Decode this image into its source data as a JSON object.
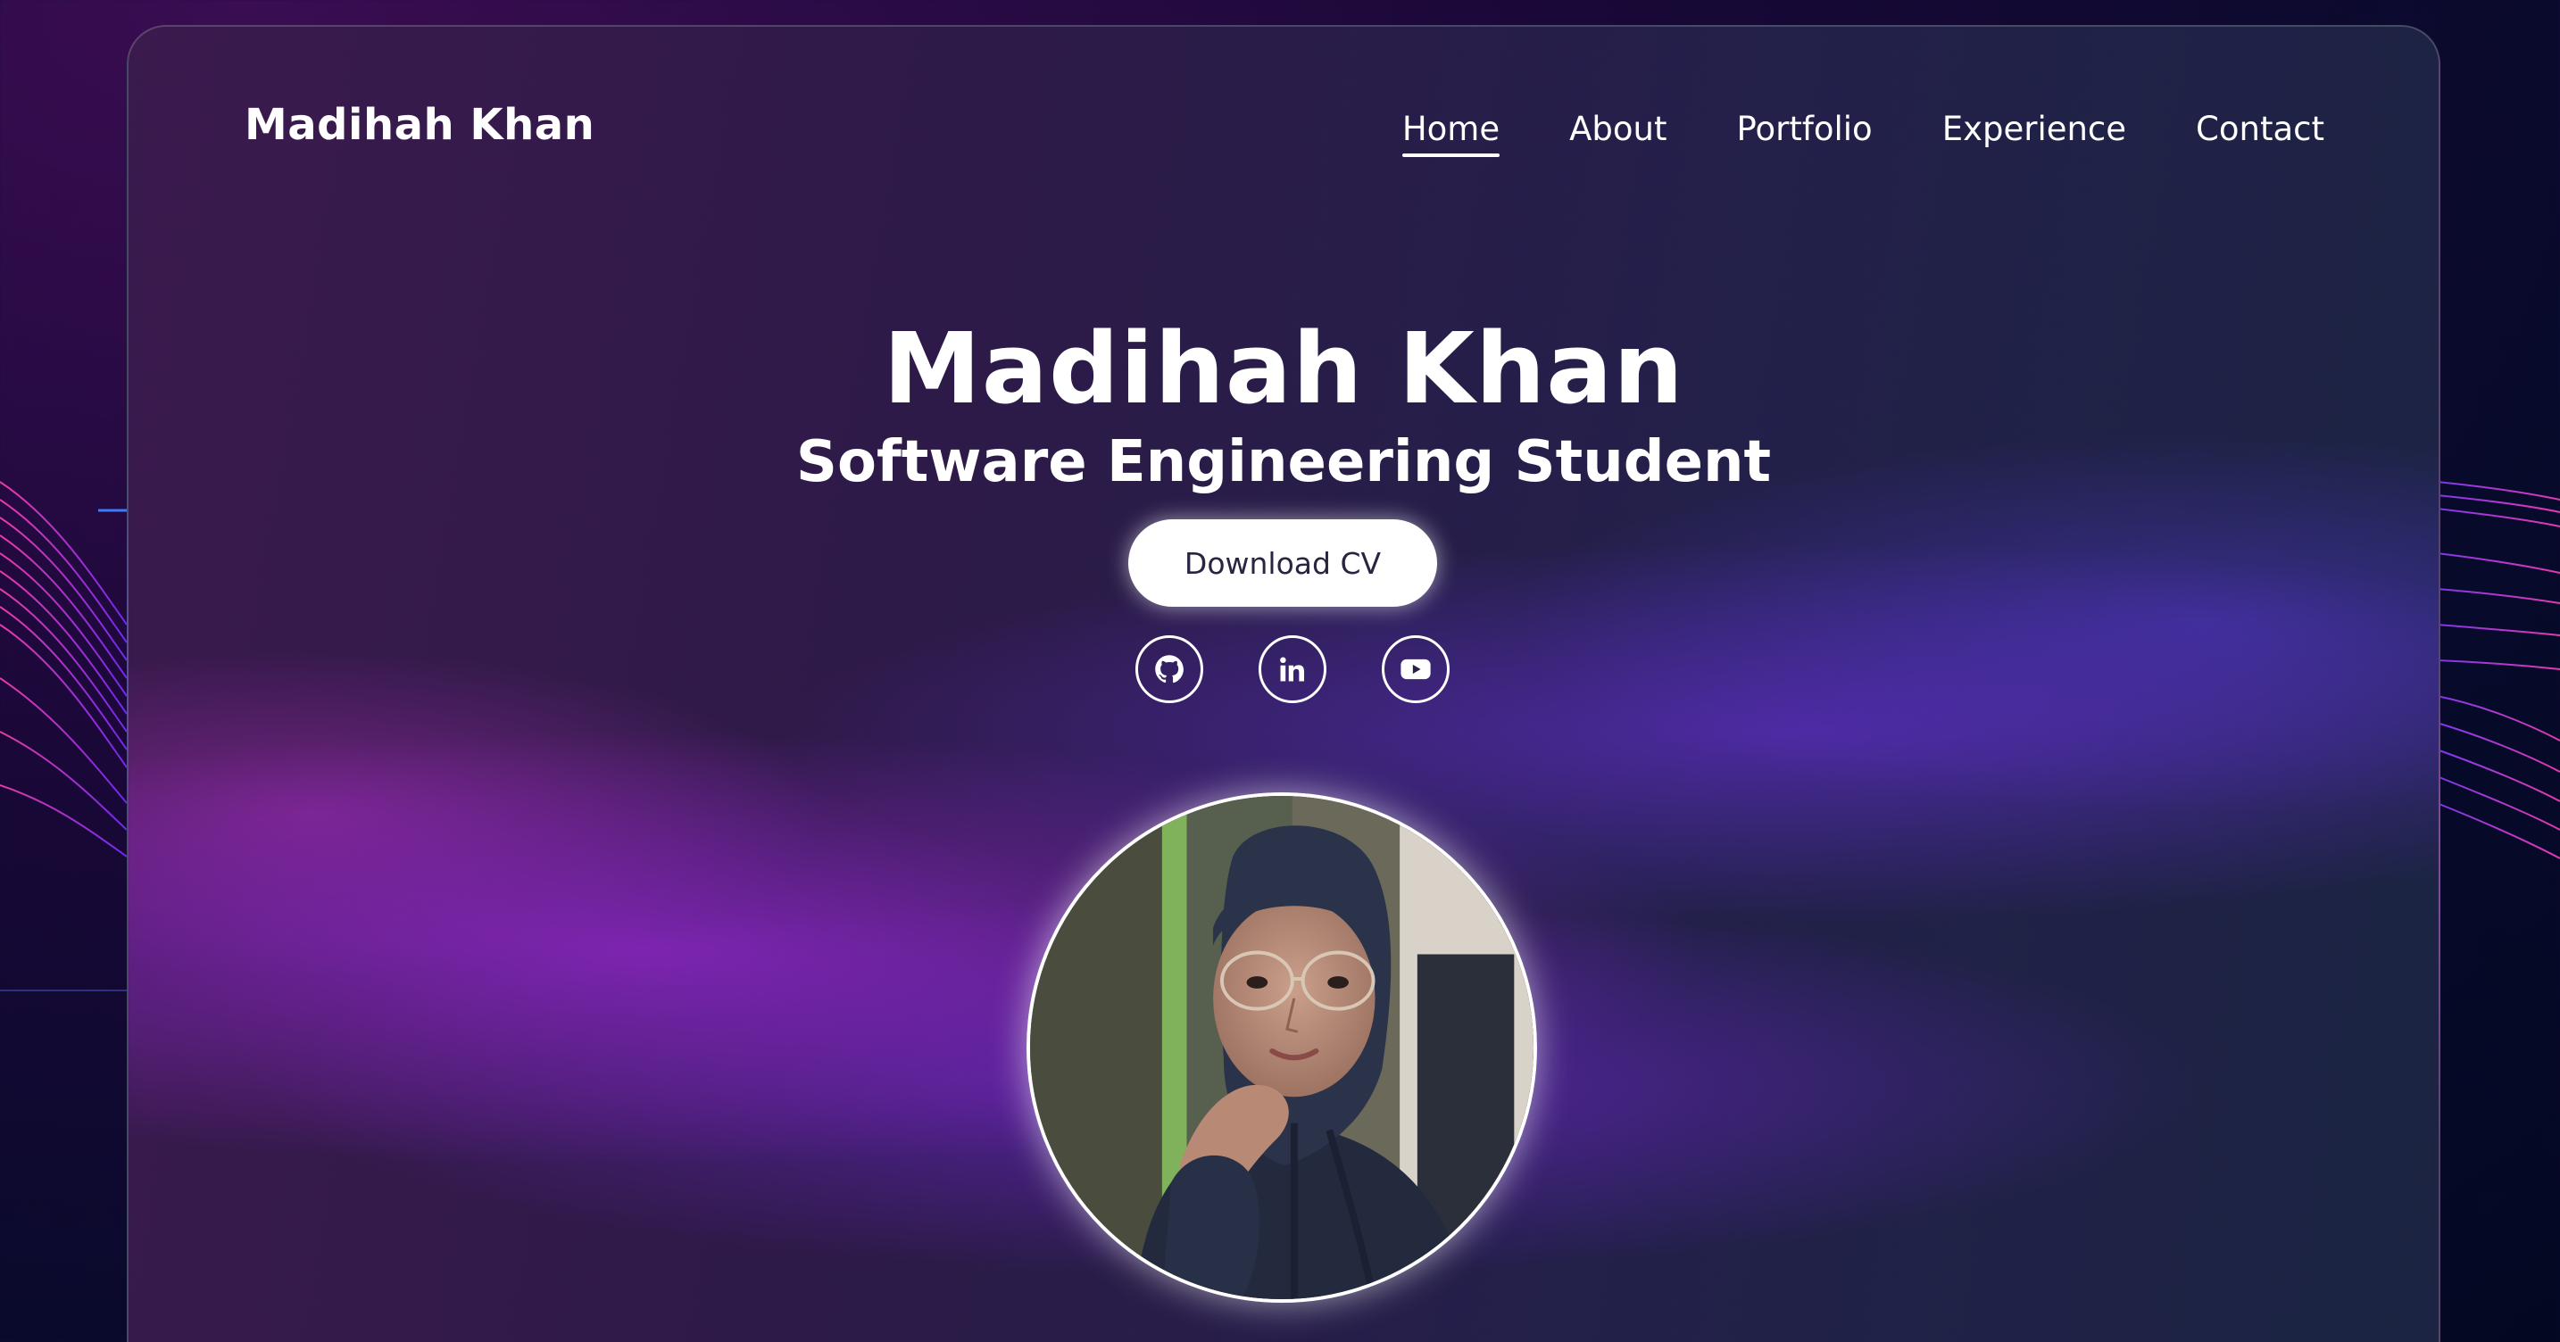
{
  "header": {
    "brand": "Madihah Khan"
  },
  "nav": {
    "items": [
      {
        "label": "Home",
        "active": true
      },
      {
        "label": "About",
        "active": false
      },
      {
        "label": "Portfolio",
        "active": false
      },
      {
        "label": "Experience",
        "active": false
      },
      {
        "label": "Contact",
        "active": false
      }
    ]
  },
  "hero": {
    "title": "Madihah Khan",
    "subtitle": "Software Engineering Student",
    "cta_label": "Download CV"
  },
  "socials": [
    {
      "icon": "github-icon"
    },
    {
      "icon": "linkedin-icon"
    },
    {
      "icon": "youtube-icon"
    }
  ],
  "colors": {
    "accent_purple": "#8a2be2",
    "accent_pink": "#d63bd0",
    "text": "#ffffff",
    "button_bg": "#ffffff",
    "button_text": "#2a2440"
  }
}
